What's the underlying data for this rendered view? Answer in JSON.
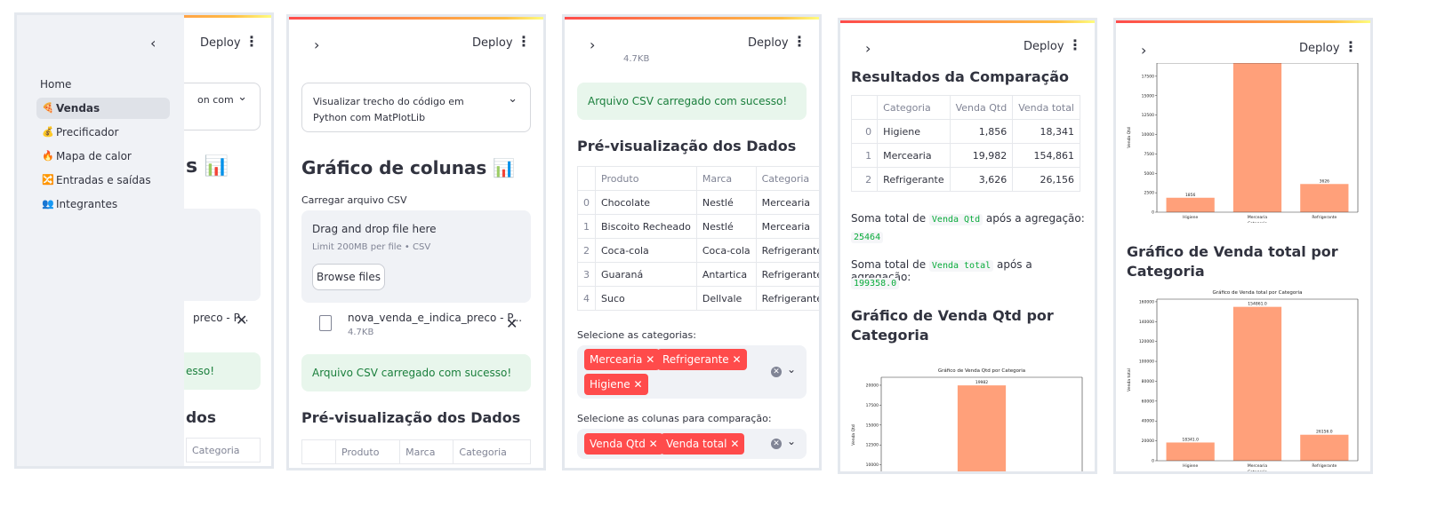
{
  "colors": {
    "accent": "#ff4b4b",
    "success_bg": "#e8f6ec",
    "bar": "#ffa07a"
  },
  "header": {
    "deploy": "Deploy"
  },
  "panel1": {
    "sidebar": {
      "items": [
        {
          "label": "Home",
          "icon": ""
        },
        {
          "label": "Vendas",
          "icon": "🍕",
          "active": true
        },
        {
          "label": "Precificador",
          "icon": "💰"
        },
        {
          "label": "Mapa de calor",
          "icon": "🔥"
        },
        {
          "label": "Entradas e saídas",
          "icon": "🔀"
        },
        {
          "label": "Integrantes",
          "icon": "👥"
        }
      ]
    },
    "expander_partial": "on com",
    "title_partial": "s 📊",
    "file_partial": "preco - P...",
    "success_partial": "esso!",
    "heading_partial": "dos",
    "col_partial": "Categoria"
  },
  "panel2": {
    "expander": "Visualizar trecho do código em Python com MatPlotLib",
    "title": "Gráfico de colunas 📊",
    "upload_label": "Carregar arquivo CSV",
    "dropzone_title": "Drag and drop file here",
    "dropzone_limit": "Limit 200MB per file • CSV",
    "browse": "Browse files",
    "file_name": "nova_venda_e_indica_preco - P...",
    "file_size": "4.7KB",
    "success": "Arquivo CSV carregado com sucesso!",
    "preview_title": "Pré-visualização dos Dados",
    "columns": [
      "Produto",
      "Marca",
      "Categoria"
    ]
  },
  "panel3": {
    "file_size_partial": "4.7KB",
    "success": "Arquivo CSV carregado com sucesso!",
    "preview_title": "Pré-visualização dos Dados",
    "columns": [
      "Produto",
      "Marca",
      "Categoria"
    ],
    "rows": [
      [
        "0",
        "Chocolate",
        "Nestlé",
        "Mercearia"
      ],
      [
        "1",
        "Biscoito Recheado",
        "Nestlé",
        "Mercearia"
      ],
      [
        "2",
        "Coca-cola",
        "Coca-cola",
        "Refrigerante"
      ],
      [
        "3",
        "Guaraná",
        "Antartica",
        "Refrigerante"
      ],
      [
        "4",
        "Suco",
        "Dellvale",
        "Refrigerante"
      ]
    ],
    "cat_label": "Selecione as categorias:",
    "cat_tags": [
      "Mercearia",
      "Refrigerante",
      "Higiene"
    ],
    "col_label": "Selecione as colunas para comparação:",
    "col_tags": [
      "Venda Qtd",
      "Venda total"
    ]
  },
  "panel4": {
    "title": "Resultados da Comparação",
    "columns": [
      "Categoria",
      "Venda Qtd",
      "Venda total"
    ],
    "rows": [
      [
        "0",
        "Higiene",
        "1,856",
        "18,341"
      ],
      [
        "1",
        "Mercearia",
        "19,982",
        "154,861"
      ],
      [
        "2",
        "Refrigerante",
        "3,626",
        "26,156"
      ]
    ],
    "sum1_prefix": "Soma total de",
    "sum1_code": "Venda Qtd",
    "sum1_suffix": "após a agregação:",
    "sum1_value": "25464",
    "sum2_prefix": "Soma total de",
    "sum2_code": "Venda total",
    "sum2_suffix": "após a agregação:",
    "sum2_value": "199358.0",
    "chart_heading_l1": "Gráfico de Venda Qtd por",
    "chart_heading_l2": "Categoria"
  },
  "panel5": {
    "chart2_heading_l1": "Gráfico de Venda total por",
    "chart2_heading_l2": "Categoria"
  },
  "chart_data": [
    {
      "type": "bar",
      "title": "Gráfico de Venda Qtd por Categoria",
      "categories": [
        "Higiene",
        "Mercearia",
        "Refrigerante"
      ],
      "values": [
        1856,
        19982,
        3626
      ],
      "value_labels": [
        "1856",
        "19982",
        "3626"
      ],
      "xlabel": "Categoria",
      "ylabel": "Venda Qtd",
      "ylim": [
        0,
        21000
      ],
      "yticks": [
        "0",
        "2500",
        "5000",
        "7500",
        "10000",
        "12500",
        "15000",
        "17500",
        "20000"
      ]
    },
    {
      "type": "bar",
      "title": "Gráfico de Venda total por Categoria",
      "categories": [
        "Higiene",
        "Mercearia",
        "Refrigerante"
      ],
      "values": [
        18341.0,
        154861.0,
        26156.0
      ],
      "value_labels": [
        "18341.0",
        "154861.0",
        "26156.0"
      ],
      "xlabel": "Categoria",
      "ylabel": "Venda total",
      "ylim": [
        0,
        162600
      ],
      "yticks": [
        "0",
        "20000",
        "40000",
        "60000",
        "80000",
        "100000",
        "120000",
        "140000",
        "160000"
      ]
    }
  ]
}
